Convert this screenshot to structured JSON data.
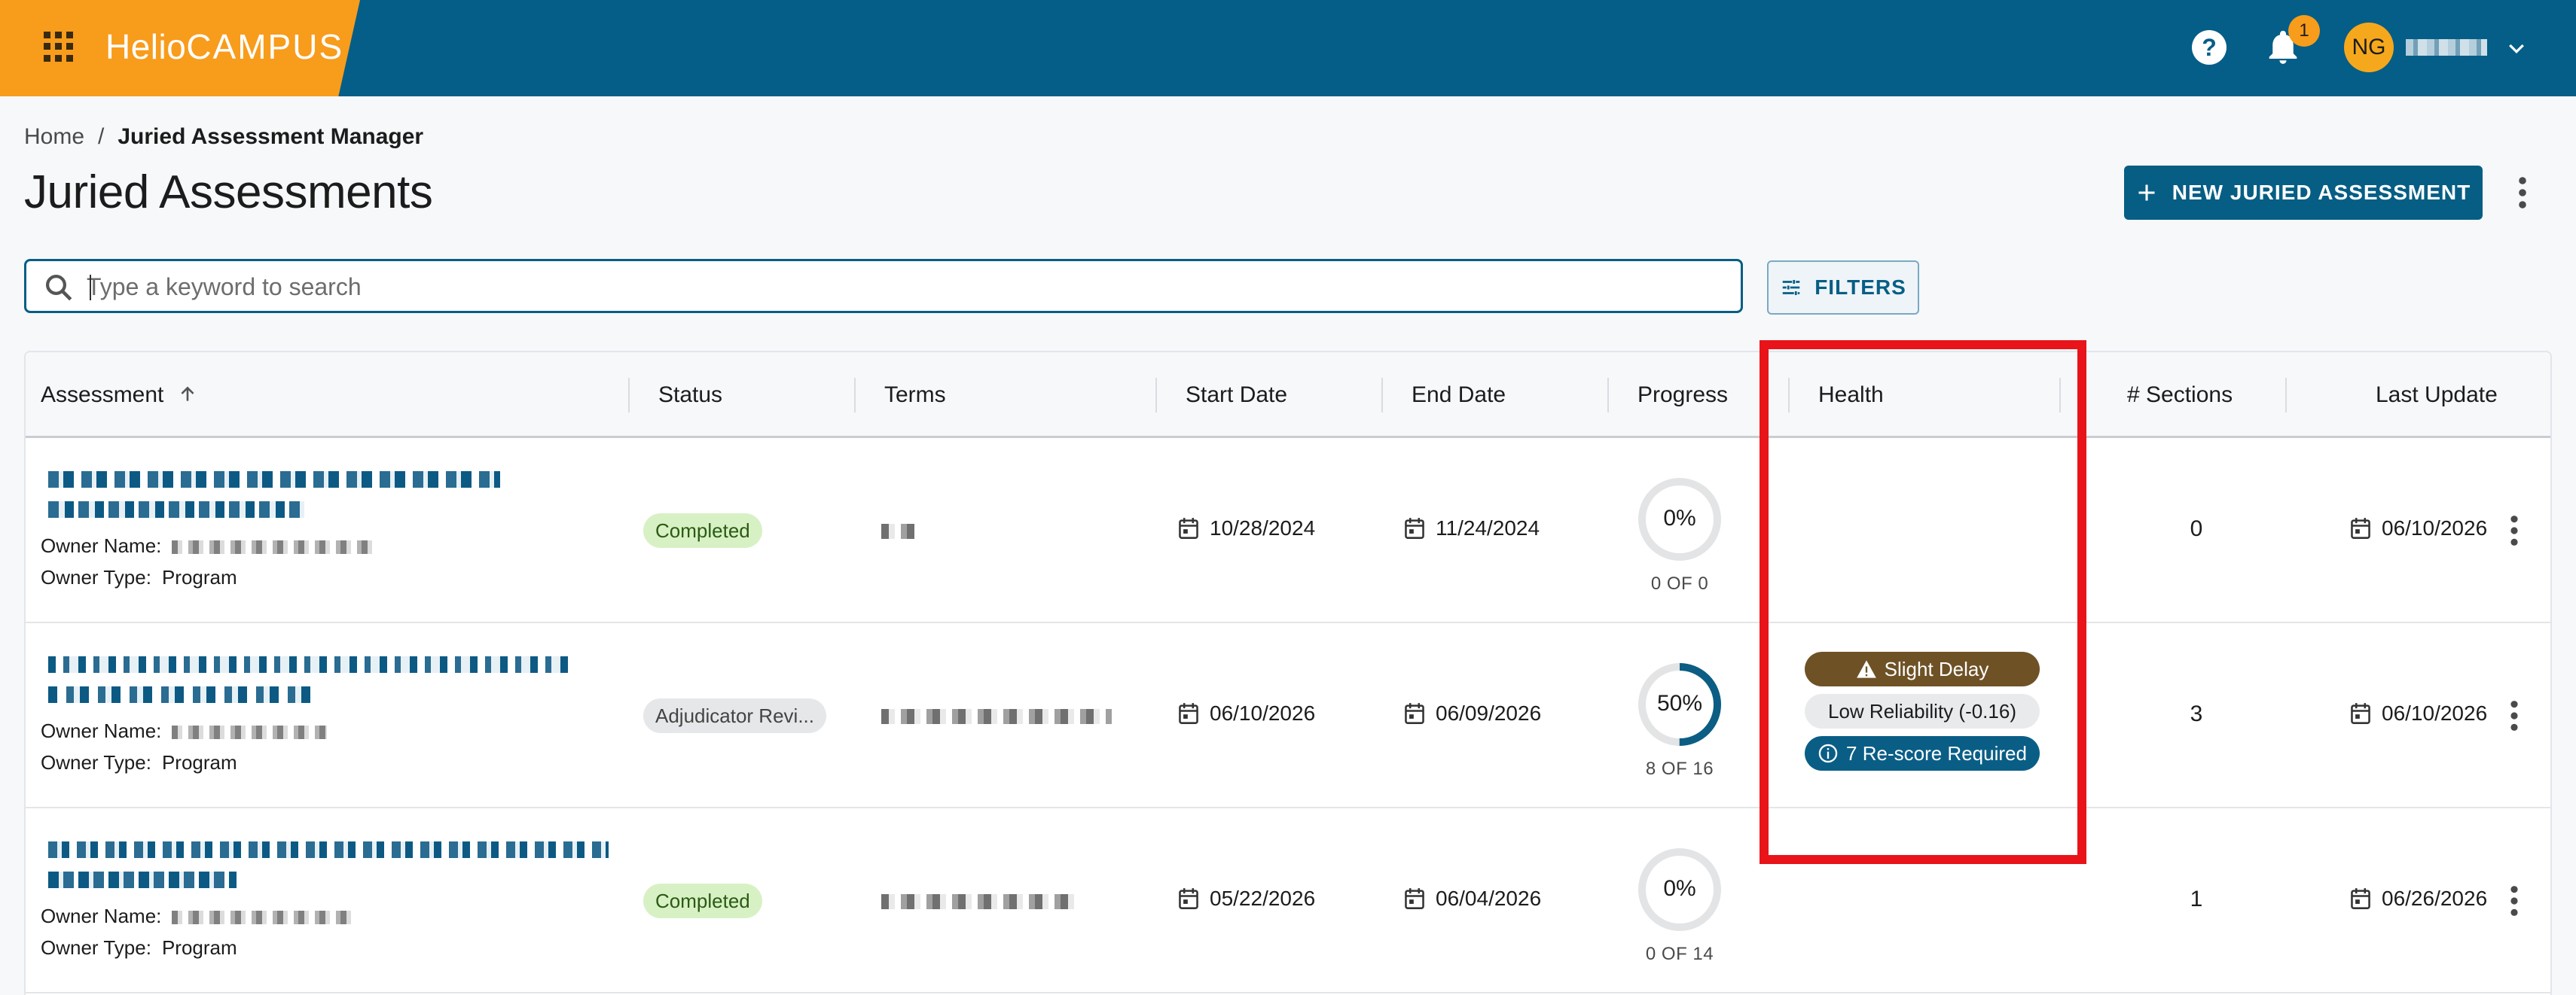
{
  "header": {
    "logo_part1": "Helio",
    "logo_part2": "CAMPUS",
    "notification_count": "1",
    "avatar_initials": "NG"
  },
  "breadcrumb": {
    "home": "Home",
    "separator": "/",
    "current": "Juried Assessment Manager"
  },
  "page": {
    "title": "Juried Assessments",
    "new_button_label": "NEW JURIED ASSESSMENT"
  },
  "search": {
    "placeholder": "Type a keyword to search",
    "value": ""
  },
  "filters_label": "FILTERS",
  "table": {
    "columns": [
      "Assessment",
      "Status",
      "Terms",
      "Start Date",
      "End Date",
      "Progress",
      "Health",
      "# Sections",
      "Last Update"
    ],
    "owner_name_label": "Owner Name:",
    "owner_type_label": "Owner Type:",
    "rows": [
      {
        "owner_type": "Program",
        "status": "Completed",
        "start_date": "10/28/2024",
        "end_date": "11/24/2024",
        "progress_pct": "0%",
        "progress_value": 0,
        "progress_sub": "0 OF 0",
        "health": [],
        "sections": "0",
        "last_update": "06/10/2026"
      },
      {
        "owner_type": "Program",
        "status": "Adjudicator Revi...",
        "start_date": "06/10/2026",
        "end_date": "06/09/2026",
        "progress_pct": "50%",
        "progress_value": 0.5,
        "progress_sub": "8 OF 16",
        "health": [
          "Slight Delay",
          "Low Reliability (-0.16)",
          "7 Re-score Required"
        ],
        "sections": "3",
        "last_update": "06/10/2026"
      },
      {
        "owner_type": "Program",
        "status": "Completed",
        "start_date": "05/22/2026",
        "end_date": "06/04/2026",
        "progress_pct": "0%",
        "progress_value": 0,
        "progress_sub": "0 OF 14",
        "health": [],
        "sections": "1",
        "last_update": "06/26/2026"
      }
    ]
  },
  "colors": {
    "header_bg": "#045e87",
    "brand_orange": "#f89c1c",
    "primary": "#075e84",
    "highlight_red": "#e8141a"
  }
}
